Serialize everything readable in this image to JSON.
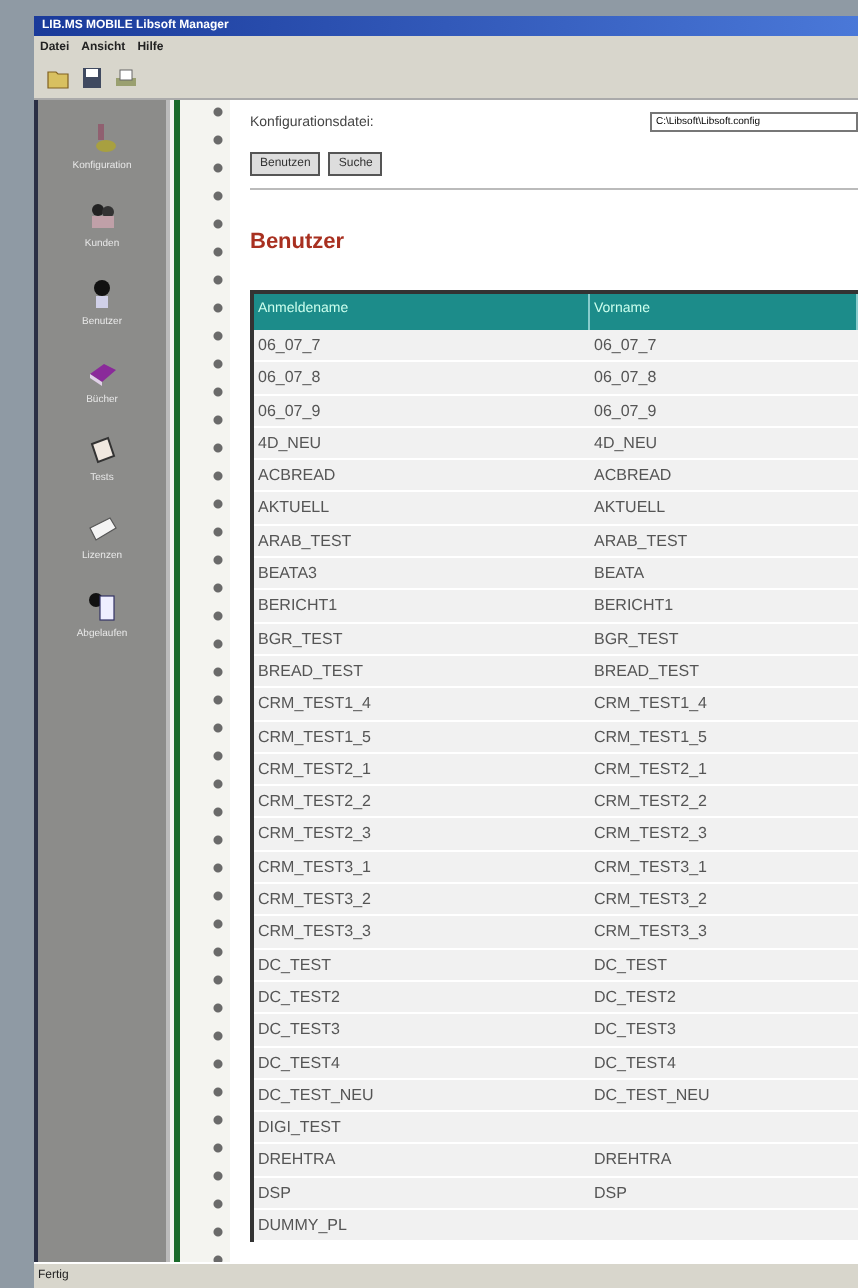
{
  "window": {
    "title": "LIB.MS MOBILE Libsoft Manager"
  },
  "menu": [
    "Datei",
    "Ansicht",
    "Hilfe"
  ],
  "toolbar": [
    {
      "kind": "folder"
    },
    {
      "kind": "save"
    },
    {
      "kind": "print"
    }
  ],
  "sidebar": {
    "items": [
      {
        "label": "Konfiguration",
        "kind": "gear"
      },
      {
        "label": "Kunden",
        "kind": "people"
      },
      {
        "label": "Benutzer",
        "kind": "person"
      },
      {
        "label": "Bücher",
        "kind": "book"
      },
      {
        "label": "Tests",
        "kind": "paper"
      },
      {
        "label": "Lizenzen",
        "kind": "letter"
      },
      {
        "label": "Abgelaufen",
        "kind": "doc"
      }
    ]
  },
  "config": {
    "label": "Konfigurationsdatei:",
    "value": "C:\\Libsoft\\Libsoft.config"
  },
  "buttons": [
    "Benutzen",
    "Suche"
  ],
  "heading": "Benutzer",
  "table": {
    "columns": [
      "Anmeldename",
      "Vorname"
    ],
    "rows": [
      [
        "06_07_7",
        "06_07_7"
      ],
      [
        "06_07_8",
        "06_07_8"
      ],
      [
        "06_07_9",
        "06_07_9"
      ],
      [
        "4D_NEU",
        "4D_NEU"
      ],
      [
        "ACBREAD",
        "ACBREAD"
      ],
      [
        "AKTUELL",
        "AKTUELL"
      ],
      [
        "ARAB_TEST",
        "ARAB_TEST"
      ],
      [
        "BEATA3",
        "BEATA"
      ],
      [
        "BERICHT1",
        "BERICHT1"
      ],
      [
        "BGR_TEST",
        "BGR_TEST"
      ],
      [
        "BREAD_TEST",
        "BREAD_TEST"
      ],
      [
        "CRM_TEST1_4",
        "CRM_TEST1_4"
      ],
      [
        "CRM_TEST1_5",
        "CRM_TEST1_5"
      ],
      [
        "CRM_TEST2_1",
        "CRM_TEST2_1"
      ],
      [
        "CRM_TEST2_2",
        "CRM_TEST2_2"
      ],
      [
        "CRM_TEST2_3",
        "CRM_TEST2_3"
      ],
      [
        "CRM_TEST3_1",
        "CRM_TEST3_1"
      ],
      [
        "CRM_TEST3_2",
        "CRM_TEST3_2"
      ],
      [
        "CRM_TEST3_3",
        "CRM_TEST3_3"
      ],
      [
        "DC_TEST",
        "DC_TEST"
      ],
      [
        "DC_TEST2",
        "DC_TEST2"
      ],
      [
        "DC_TEST3",
        "DC_TEST3"
      ],
      [
        "DC_TEST4",
        "DC_TEST4"
      ],
      [
        "DC_TEST_NEU",
        "DC_TEST_NEU"
      ],
      [
        "DIGI_TEST",
        ""
      ],
      [
        "DREHTRA",
        "DREHTRA"
      ],
      [
        "DSP",
        "DSP"
      ],
      [
        "DUMMY_PL",
        ""
      ]
    ]
  },
  "status_bar": "Fertig"
}
